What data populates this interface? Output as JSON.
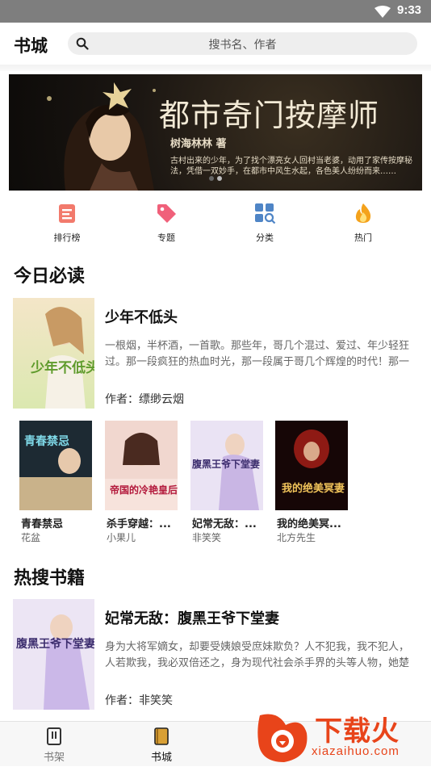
{
  "status": {
    "time": "9:33"
  },
  "header": {
    "title": "书城",
    "search_placeholder": "搜书名、作者"
  },
  "banner": {
    "title": "都市奇门按摩师",
    "author": "树海林林  著",
    "desc": "古村出来的少年，为了找个漂亮女人回村当老婆，动用了家传按摩秘法，凭借一双妙手，在都市中风生水起，各色美人纷纷而来……"
  },
  "categories": [
    {
      "label": "排行榜",
      "icon": "ranking-icon"
    },
    {
      "label": "专题",
      "icon": "tag-icon"
    },
    {
      "label": "分类",
      "icon": "category-grid-icon"
    },
    {
      "label": "热门",
      "icon": "fire-icon"
    }
  ],
  "today": {
    "heading": "今日必读",
    "featured": {
      "title": "少年不低头",
      "desc": "一根烟，半杯酒，一首歌。那些年，哥几个混过、爱过、年少轻狂过。那一段疯狂的热血时光，那一段属于哥几个辉煌的时代！那一",
      "author": "作者：缥缈云烟",
      "cover_text": "少年不低头"
    },
    "books": [
      {
        "title": "青春禁忌",
        "author": "花盆",
        "cover_text": "青春禁忌"
      },
      {
        "title": "杀手穿越：...",
        "author": "小果儿",
        "cover_text": "帝国的冷艳皇后"
      },
      {
        "title": "妃常无敌：...",
        "author": "非笑笑",
        "cover_text": "腹黑王爷下堂妻"
      },
      {
        "title": "我的绝美冥...",
        "author": "北方先生",
        "cover_text": "我的绝美冥妻"
      }
    ]
  },
  "hot": {
    "heading": "热搜书籍",
    "featured": {
      "title": "妃常无敌：腹黑王爷下堂妻",
      "desc": "身为大将军嫡女，却要受姨娘受庶妹欺负？人不犯我，我不犯人，人若欺我，我必双倍还之，身为现代社会杀手界的头等人物，她楚",
      "author": "作者：非笑笑",
      "cover_text": "腹黑王爷下堂妻"
    }
  },
  "bottom_nav": [
    {
      "label": "书架",
      "icon": "bookshelf-icon"
    },
    {
      "label": "书城",
      "icon": "bookstore-icon"
    }
  ],
  "watermark": {
    "text": "下载火",
    "url": "xiazaihuo.com"
  },
  "colors": {
    "accent": "#d9a035",
    "tab_active": "#111111",
    "tab_inactive": "#777777",
    "watermark": "#e8441a"
  }
}
